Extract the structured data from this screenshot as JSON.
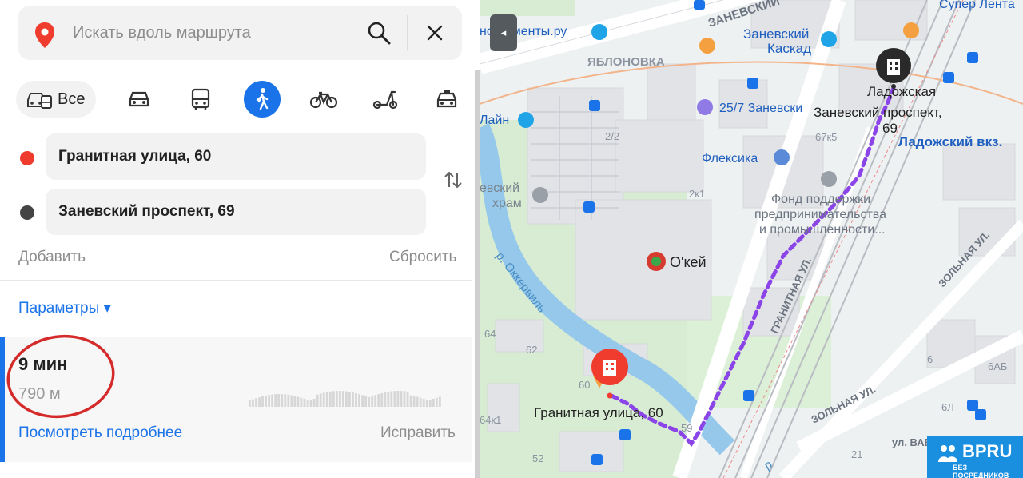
{
  "search": {
    "placeholder": "Искать вдоль маршрута"
  },
  "modes": {
    "all_label": "Все",
    "items": [
      "car-icon",
      "bus-icon",
      "walk-icon",
      "bike-icon",
      "scooter-icon",
      "taxi-icon"
    ],
    "active": "walk-icon"
  },
  "waypoints": {
    "from": {
      "value": "Гранитная улица, 60",
      "color": "#f03c2e"
    },
    "to": {
      "value": "Заневский проспект, 69",
      "color": "#444444"
    }
  },
  "actions": {
    "add_label": "Добавить",
    "reset_label": "Сбросить"
  },
  "params_label": "Параметры ▾",
  "route": {
    "time": "9 мин",
    "distance": "790 м",
    "details_label": "Посмотреть подробнее",
    "fix_label": "Исправить"
  },
  "map": {
    "collapse_label": "◂",
    "accent_route": "#8b44e8",
    "labels": {
      "zanevsky_street": "ЗАНЕВСКИЙ",
      "super_lenta": "Супер Лента",
      "instruments": "нструменты.ру",
      "zanevsky_kaskad_1": "Заневский",
      "zanevsky_kaskad_2": "Каскад",
      "yablonovka": "ЯБЛОНОВКА",
      "ladozhskaya": "Ладожская",
      "hotel": "25/7 Заневски",
      "dest_1": "Заневский проспект,",
      "dest_2": "69",
      "line": "Лайн",
      "house_2_2": "2/2",
      "house_67k5": "67к5",
      "ladozhsky_vkz": "Ладожский вкз.",
      "fleksika": "Флексика",
      "church_1": "евский",
      "church_2": "храм",
      "house_2k1": "2к1",
      "fund_1": "Фонд поддержки",
      "fund_2": "предпринимательства",
      "fund_3": "и промышленности...",
      "okey": "О'кей",
      "river": "р. Оккервиль",
      "granitnaya_ul": "ГРАНИТНАЯ УЛ.",
      "zolnaya_ul_1": "ЗОЛЬНАЯ УЛ.",
      "zolnaya_ul_2": "ЗОЛЬНАЯ УЛ.",
      "house_64": "64",
      "house_62": "62",
      "house_60": "60",
      "start_label": "Гранитная улица, 60",
      "house_59": "59",
      "house_64k1": "64к1",
      "house_52": "52",
      "house_6": "6",
      "house_6ab": "6АБ",
      "house_6l": "6Л",
      "house_21": "21",
      "ul_vav": "ул. ВАВ",
      "river_2": "р"
    }
  },
  "badge": {
    "title": "BPRU",
    "subtitle": "БЕЗ ПОСРЕДНИКОВ"
  }
}
